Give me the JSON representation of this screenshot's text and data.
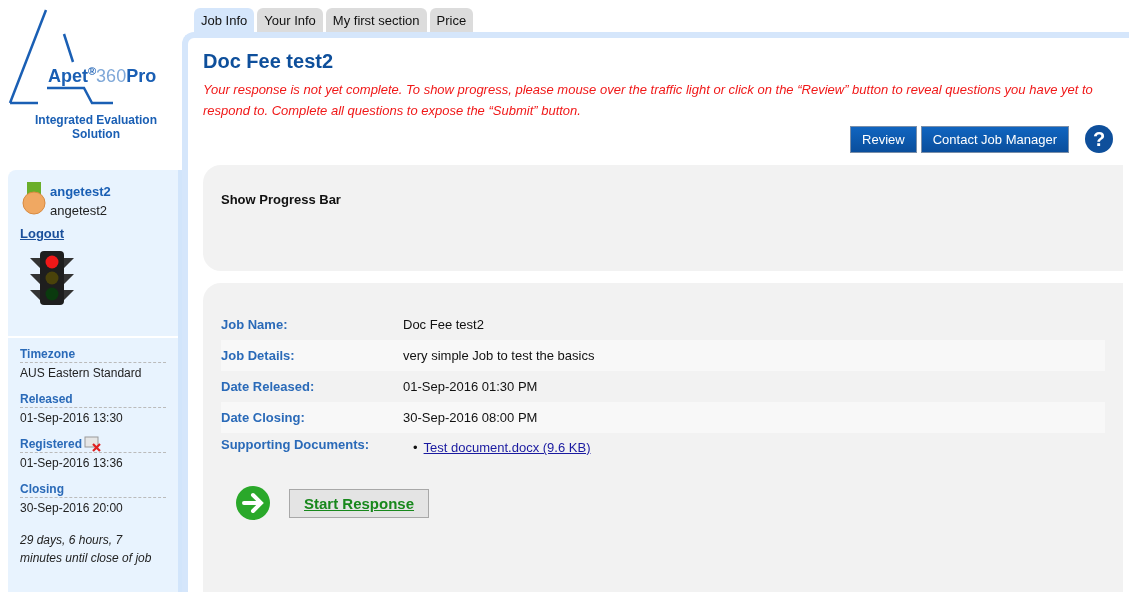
{
  "logo": {
    "parts": [
      {
        "text": "Apet",
        "kind": "strong"
      },
      {
        "text": "®",
        "kind": "sup"
      },
      {
        "text": "360",
        "kind": "light"
      },
      {
        "text": "Pro",
        "kind": "strong"
      }
    ],
    "tagline": "Integrated Evaluation Solution"
  },
  "user": {
    "link": "angetest2",
    "name": "angetest2",
    "logout": "Logout"
  },
  "traffic_light": {
    "lights": [
      {
        "on": true
      },
      {
        "on": false
      },
      {
        "on": false
      }
    ]
  },
  "sidebar_info": [
    {
      "label": "Timezone",
      "value": "AUS Eastern Standard",
      "removable": false
    },
    {
      "label": "Released",
      "value": "01-Sep-2016 13:30",
      "removable": false
    },
    {
      "label": "Registered",
      "value": "01-Sep-2016 13:36",
      "removable": true
    },
    {
      "label": "Closing",
      "value": "30-Sep-2016 20:00",
      "removable": false
    }
  ],
  "countdown": "29 days, 6 hours, 7 minutes until close of job",
  "tabs": [
    {
      "label": "Job Info",
      "selected": true
    },
    {
      "label": "Your Info",
      "selected": false
    },
    {
      "label": "My first section",
      "selected": false
    },
    {
      "label": "Price",
      "selected": false
    }
  ],
  "title": "Doc Fee test2",
  "warning": "Your response is not yet complete. To show progress, please mouse over the traffic light or click on the “Review” button to reveal questions you have yet to respond to. Complete all questions to expose the “Submit” button.",
  "buttons": [
    "Review",
    "Contact Job Manager"
  ],
  "help": "?",
  "progress_panel": {
    "label": "Show Progress Bar"
  },
  "job_fields": [
    {
      "label": "Job Name:",
      "value": "Doc Fee test2"
    },
    {
      "label": "Job Details:",
      "value": "very simple Job to test the basics"
    },
    {
      "label": "Date Released:",
      "value": "01-Sep-2016 01:30 PM"
    },
    {
      "label": "Date Closing:",
      "value": "30-Sep-2016 08:00 PM"
    }
  ],
  "supporting_documents": {
    "label": "Supporting Documents:",
    "bullet": "•",
    "files": [
      "Test document.docx (9.6 KB)"
    ]
  },
  "start_button": "Start Response"
}
